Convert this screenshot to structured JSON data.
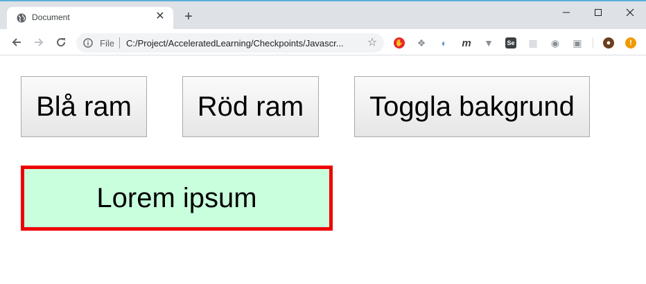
{
  "browser": {
    "tab": {
      "title": "Document",
      "close_glyph": "✕"
    },
    "new_tab_glyph": "+",
    "window_controls": {
      "minimize": "—",
      "maximize": "☐",
      "close": "✕"
    },
    "address": {
      "scheme_label": "File",
      "url": "C:/Project/AcceleratedLearning/Checkpoints/Javascr..."
    },
    "extensions": [
      {
        "name": "adblock-icon",
        "glyph": "✋",
        "color": "#e8262b"
      },
      {
        "name": "dropbox-icon",
        "glyph": "❖",
        "color": "#8a8f96"
      },
      {
        "name": "compass-icon",
        "glyph": "◐",
        "color": "#5b8fd6"
      },
      {
        "name": "m-icon",
        "glyph": "m",
        "color": "#3c4043"
      },
      {
        "name": "v-icon",
        "glyph": "▼",
        "color": "#8a8f96"
      },
      {
        "name": "selenium-icon",
        "glyph": "Se",
        "color": "#3c4043"
      },
      {
        "name": "grid-icon",
        "glyph": "▦",
        "color": "#c8cbd0"
      },
      {
        "name": "camera-icon",
        "glyph": "◉",
        "color": "#8a8f96"
      },
      {
        "name": "window-icon",
        "glyph": "▣",
        "color": "#8a8f96"
      },
      {
        "name": "avatar-icon",
        "glyph": "●",
        "color": "#6b3e1e"
      },
      {
        "name": "alert-icon",
        "glyph": "!",
        "color": "#f29900"
      }
    ]
  },
  "page": {
    "buttons": {
      "blue_frame": "Blå ram",
      "red_frame": "Röd ram",
      "toggle_background": "Toggla bakgrund"
    },
    "box": {
      "text": "Lorem ipsum",
      "background": "#c9ffdd",
      "border_color": "#ee0000"
    }
  }
}
